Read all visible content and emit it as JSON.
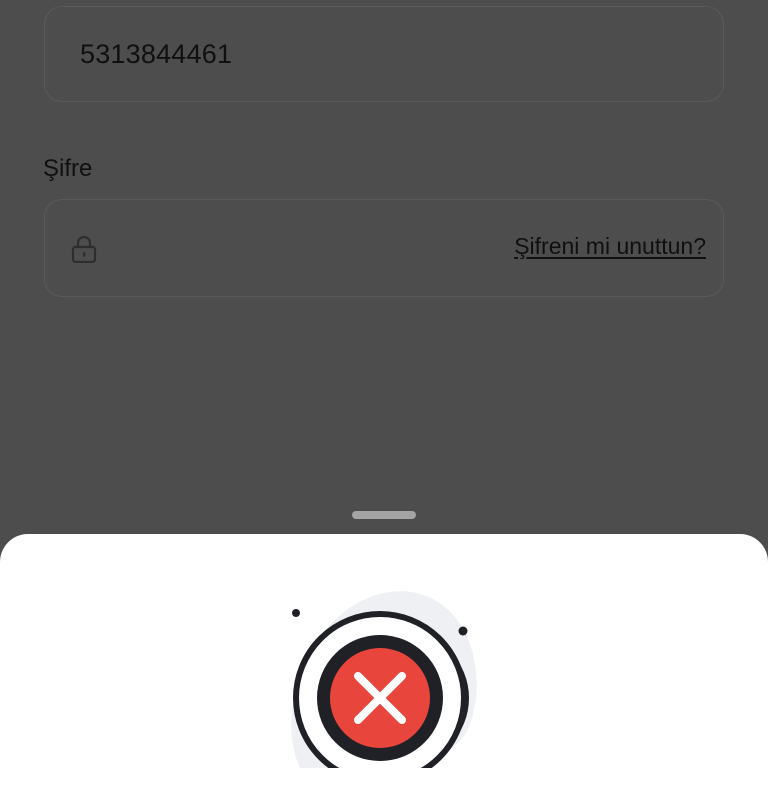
{
  "login_form": {
    "phone_value": "5313844461",
    "password_label": "Şifre",
    "forgot_password_link": "Şifreni mi unuttun?"
  },
  "icons": {
    "lock": "lock-icon",
    "error": "error-x-icon"
  },
  "colors": {
    "overlay_background": "#4d4d4d",
    "sheet_background": "#ffffff",
    "error_red": "#e8453c",
    "illustration_dark": "#1f2126",
    "blob_gray": "#eef0f3"
  }
}
